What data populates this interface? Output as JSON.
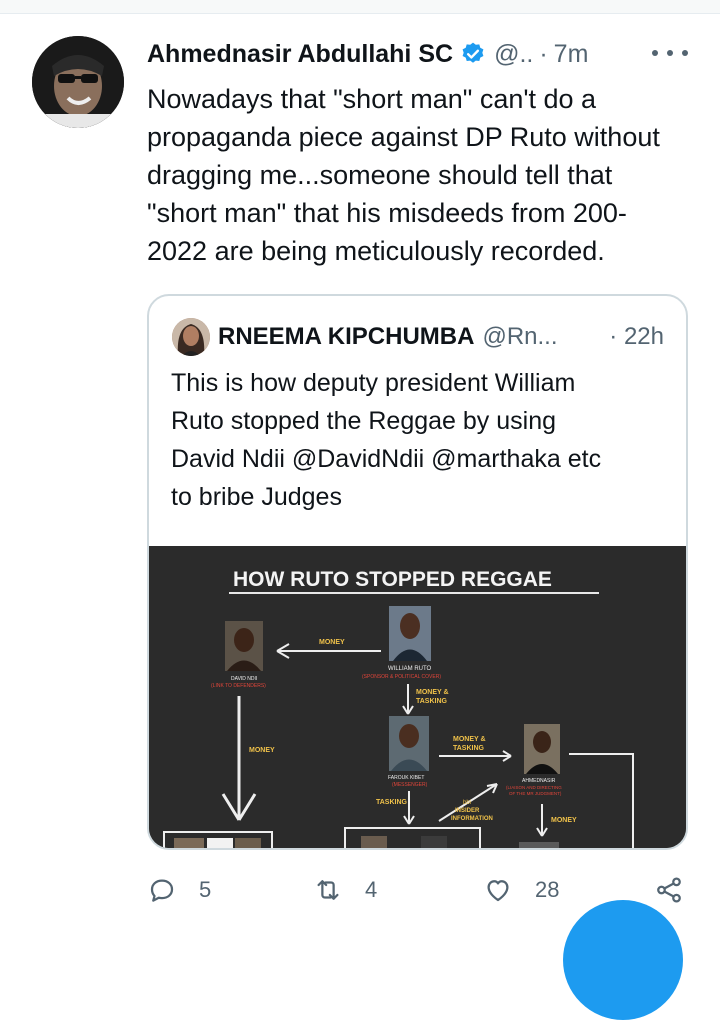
{
  "tweet": {
    "author_name": "Ahmednasir Abdullahi SC",
    "handle": "@..",
    "separator": "·",
    "time": "7m",
    "text": "Nowadays that \"short man\" can't do a\npropaganda piece against DP Ruto without\ndragging me...someone should tell that\n\"short man\" that his misdeeds from 200-\n2022 are being meticulously recorded."
  },
  "quoted": {
    "author_name": "RNEEMA KIPCHUMBA",
    "handle": "@Rn...",
    "time": "· 22h",
    "text": "This is how deputy president William\nRuto stopped the Reggae by using\nDavid Ndii @DavidNdii @marthaka etc\nto bribe Judges",
    "image": {
      "title": "HOW RUTO STOPPED REGGAE",
      "labels": {
        "money_top": "MONEY",
        "william": "WILLIAM RUTO",
        "william_sub": "(SPONSOR & POLITICAL COVER)",
        "david": "DAVID NDII",
        "david_sub": "(LINK TO DEFENDERS)",
        "money_tasking_1": "MONEY &",
        "money_tasking_1b": "TASKING",
        "money_left": "MONEY",
        "farouk": "FAROUK KIBET",
        "farouk_sub": "(MESSENGER)",
        "money_tasking_2": "MONEY &",
        "money_tasking_2b": "TASKING",
        "ahmednasir": "AHMEDNASIR",
        "ahmednasir_sub": "(LIAISON AND DIRECTING",
        "ahmednasir_sub2": "OF THE MR JUDGMENT)",
        "tasking": "TASKING",
        "bbi": "bbi",
        "insider": "INSIDER",
        "information": "INFORMATION",
        "money_right": "MONEY"
      }
    }
  },
  "actions": {
    "replies": "5",
    "retweets": "4",
    "likes": "28"
  },
  "colors": {
    "verified": "#1d9bf0",
    "muted": "#536471",
    "chalkboard": "#2b2b2b",
    "chalk_orange": "#f0c24a",
    "chalk_red": "#e0453a"
  }
}
